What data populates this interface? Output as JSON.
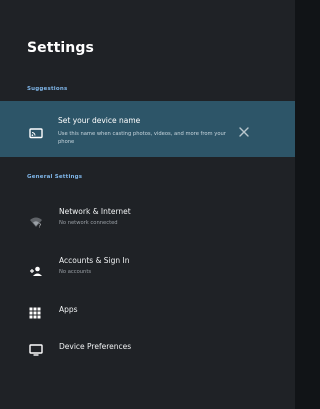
{
  "header": {
    "title": "Settings"
  },
  "suggestions": {
    "label": "Suggestions",
    "item": {
      "title": "Set your device name",
      "subtitle": "Use this name when casting photos, videos, and more from your phone",
      "icon": "cast-icon"
    }
  },
  "general": {
    "label": "General Settings",
    "items": [
      {
        "label": "Network & Internet",
        "sub": "No network connected",
        "icon": "wifi-off-icon"
      },
      {
        "label": "Accounts & Sign In",
        "sub": "No accounts",
        "icon": "add-person-icon"
      },
      {
        "label": "Apps",
        "icon": "apps-grid-icon"
      },
      {
        "label": "Device Preferences",
        "icon": "tv-icon"
      }
    ]
  },
  "colors": {
    "accent": "#7fb6e9",
    "highlight": "#2d5568",
    "panel": "#1f2226"
  }
}
